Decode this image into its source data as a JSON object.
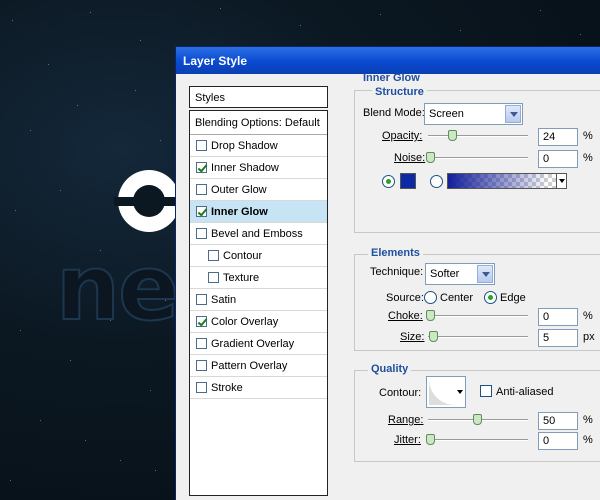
{
  "dialog": {
    "title": "Layer Style"
  },
  "styles_panel": {
    "header": "Styles",
    "blending_options": "Blending Options: Default",
    "items": [
      {
        "label": "Drop Shadow",
        "checked": false,
        "selected": false,
        "indent": false
      },
      {
        "label": "Inner Shadow",
        "checked": true,
        "selected": false,
        "indent": false
      },
      {
        "label": "Outer Glow",
        "checked": false,
        "selected": false,
        "indent": false
      },
      {
        "label": "Inner Glow",
        "checked": true,
        "selected": true,
        "indent": false
      },
      {
        "label": "Bevel and Emboss",
        "checked": false,
        "selected": false,
        "indent": false
      },
      {
        "label": "Contour",
        "checked": false,
        "selected": false,
        "indent": true
      },
      {
        "label": "Texture",
        "checked": false,
        "selected": false,
        "indent": true
      },
      {
        "label": "Satin",
        "checked": false,
        "selected": false,
        "indent": false
      },
      {
        "label": "Color Overlay",
        "checked": true,
        "selected": false,
        "indent": false
      },
      {
        "label": "Gradient Overlay",
        "checked": false,
        "selected": false,
        "indent": false
      },
      {
        "label": "Pattern Overlay",
        "checked": false,
        "selected": false,
        "indent": false
      },
      {
        "label": "Stroke",
        "checked": false,
        "selected": false,
        "indent": false
      }
    ]
  },
  "inner_glow": {
    "title": "Inner Glow",
    "structure": {
      "title": "Structure",
      "blend_mode_label": "Blend Mode:",
      "blend_mode_value": "Screen",
      "opacity_label": "Opacity:",
      "opacity_value": "24",
      "opacity_unit": "%",
      "noise_label": "Noise:",
      "noise_value": "0",
      "noise_unit": "%",
      "color_swatch": "#0d2aa4"
    },
    "elements": {
      "title": "Elements",
      "technique_label": "Technique:",
      "technique_value": "Softer",
      "source_label": "Source:",
      "source_center": "Center",
      "source_edge": "Edge",
      "choke_label": "Choke:",
      "choke_value": "0",
      "choke_unit": "%",
      "size_label": "Size:",
      "size_value": "5",
      "size_unit": "px"
    },
    "quality": {
      "title": "Quality",
      "contour_label": "Contour:",
      "anti_aliased_label": "Anti-aliased",
      "range_label": "Range:",
      "range_value": "50",
      "range_unit": "%",
      "jitter_label": "Jitter:",
      "jitter_value": "0",
      "jitter_unit": "%"
    }
  }
}
